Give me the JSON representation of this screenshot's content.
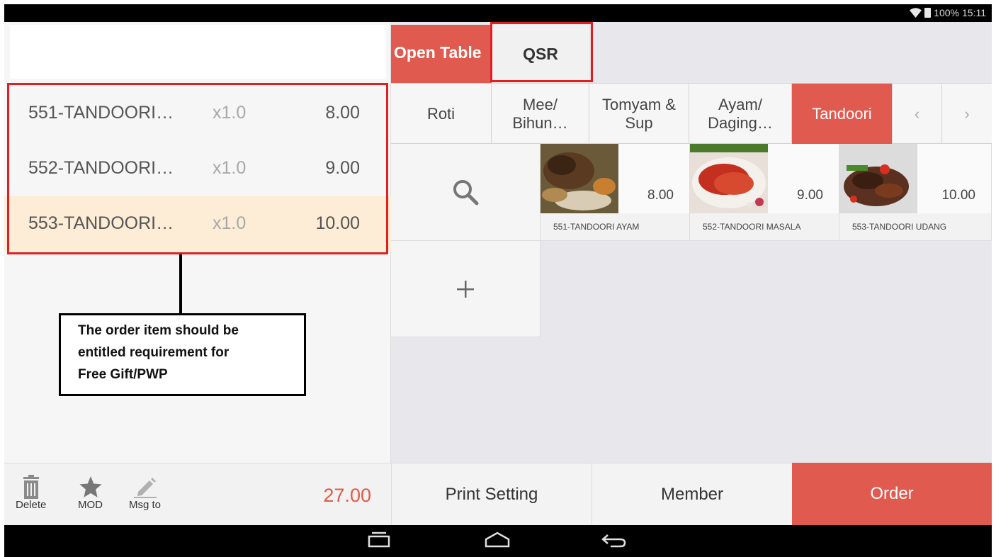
{
  "status": {
    "battery": "100%",
    "time": "15:11"
  },
  "order": {
    "items": [
      {
        "name": "551-TANDOORI…",
        "qty": "x1.0",
        "price": "8.00"
      },
      {
        "name": "552-TANDOORI…",
        "qty": "x1.0",
        "price": "9.00"
      },
      {
        "name": "553-TANDOORI…",
        "qty": "x1.0",
        "price": "10.00"
      }
    ],
    "total": "27.00"
  },
  "callout": {
    "line1": "The order item should be",
    "line2": "entitled requirement for",
    "line3": "Free Gift/PWP"
  },
  "toolbar": {
    "delete": "Delete",
    "mod": "MOD",
    "msg": "Msg to"
  },
  "tabs": {
    "open_table": "Open Table",
    "qsr": "QSR"
  },
  "categories": {
    "roti": "Roti",
    "mee_1": "Mee/",
    "mee_2": "Bihun…",
    "tomyam_1": "Tomyam &",
    "tomyam_2": "Sup",
    "ayam_1": "Ayam/",
    "ayam_2": "Daging…",
    "tandoori": "Tandoori",
    "prev": "‹",
    "next": "›"
  },
  "products": [
    {
      "name": "551-TANDOORI AYAM",
      "price": "8.00"
    },
    {
      "name": "552-TANDOORI MASALA",
      "price": "9.00"
    },
    {
      "name": "553-TANDOORI UDANG",
      "price": "10.00"
    }
  ],
  "actions": {
    "print": "Print Setting",
    "member": "Member",
    "order": "Order"
  },
  "colors": {
    "accent": "#e05a4f",
    "highlight": "#fdecd6",
    "annotation": "#e02020"
  }
}
